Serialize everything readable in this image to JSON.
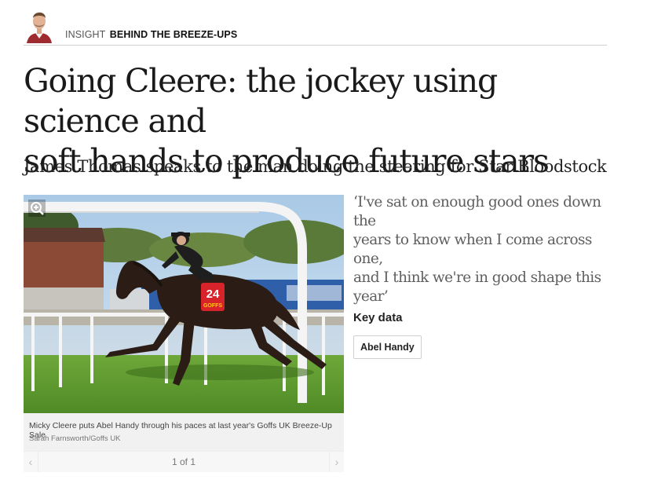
{
  "header": {
    "kicker_section": "INSIGHT",
    "kicker_series": "BEHIND THE BREEZE-UPS"
  },
  "article": {
    "headline_line1": "Going Cleere: the jockey using science and",
    "headline_line2": "soft hands to produce future stars",
    "standfirst": "James Thomas speaks to the man doing the steering for Star Bloodstock"
  },
  "figure": {
    "saddlecloth_number": "24",
    "saddlecloth_text": "GOFFS",
    "caption": "Micky Cleere puts Abel Handy through his paces at last year's Goffs UK Breeze-Up Sale",
    "credit": "Sarah Farnsworth/Goffs UK",
    "pager": "1 of 1",
    "zoom_icon": "zoom-in-icon",
    "prev_icon": "chevron-left-icon",
    "next_icon": "chevron-right-icon"
  },
  "pullquote": {
    "line1": "‘I've sat on enough good ones down the",
    "line2": "years to know when I come across one,",
    "line3": "and I think we're in good shape this",
    "line4": "year’"
  },
  "key_data": {
    "title": "Key data",
    "tags": [
      "Abel Handy"
    ]
  },
  "colors": {
    "saddlecloth_red": "#d8232a",
    "turf_green": "#5a9a2e",
    "sky_blue": "#bcd6ec"
  }
}
